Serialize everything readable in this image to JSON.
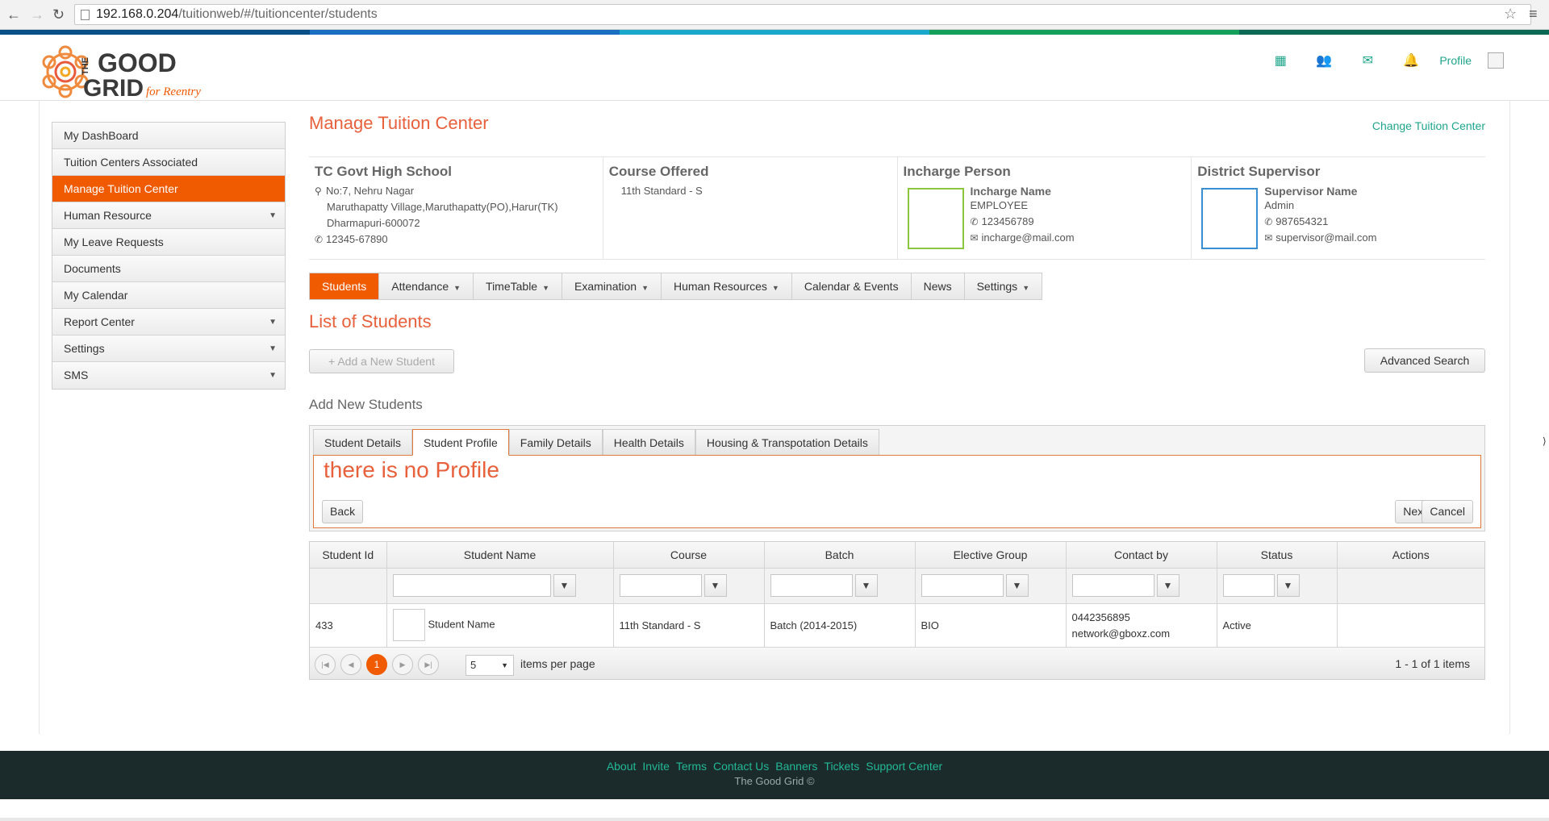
{
  "browser": {
    "url_host": "192.168.0.204",
    "url_path": "/tuitionweb/#/tuitioncenter/students"
  },
  "brand": {
    "logo_the": "THE",
    "logo_good": "GOOD",
    "logo_grid": "GRID",
    "logo_tag": "for Reentry",
    "stripe_colors": [
      "#0a4f85",
      "#1b6fc0",
      "#1ba7c9",
      "#13a05a",
      "#0c6a54"
    ],
    "accent": "#f05a00",
    "title_color": "#e8603c",
    "link_color": "#1fa58c"
  },
  "header": {
    "icons": [
      "apps-grid-icon",
      "users-icon",
      "mail-icon",
      "bell-icon"
    ],
    "profile_label": "Profile"
  },
  "sidebar": {
    "items": [
      {
        "label": "My DashBoard",
        "has_caret": false
      },
      {
        "label": "Tuition Centers Associated",
        "has_caret": false
      },
      {
        "label": "Manage Tuition Center",
        "has_caret": false,
        "active": true
      },
      {
        "label": "Human Resource",
        "has_caret": true
      },
      {
        "label": "My Leave Requests",
        "has_caret": false
      },
      {
        "label": "Documents",
        "has_caret": false
      },
      {
        "label": "My Calendar",
        "has_caret": false
      },
      {
        "label": "Report Center",
        "has_caret": true
      },
      {
        "label": "Settings",
        "has_caret": true
      },
      {
        "label": "SMS",
        "has_caret": true
      }
    ]
  },
  "main": {
    "title": "Manage Tuition Center",
    "change_link": "Change Tuition Center",
    "center": {
      "name": "TC Govt High School",
      "address1": "No:7, Nehru Nagar",
      "address2": "Maruthapatty Village,Maruthapatty(PO),Harur(TK)",
      "address3": "Dharmapuri-600072",
      "phone": "12345-67890"
    },
    "course": {
      "heading": "Course Offered",
      "value": "11th Standard - S"
    },
    "incharge": {
      "heading": "Incharge Person",
      "name": "Incharge Name",
      "role": "EMPLOYEE",
      "phone": "123456789",
      "email": "incharge@mail.com"
    },
    "supervisor": {
      "heading": "District Supervisor",
      "name": "Supervisor Name",
      "role": "Admin",
      "phone": "987654321",
      "email": "supervisor@mail.com"
    },
    "tabs": [
      {
        "label": "Students",
        "caret": false,
        "active": true
      },
      {
        "label": "Attendance",
        "caret": true
      },
      {
        "label": "TimeTable",
        "caret": true
      },
      {
        "label": "Examination",
        "caret": true
      },
      {
        "label": "Human Resources",
        "caret": true
      },
      {
        "label": "Calendar & Events",
        "caret": false
      },
      {
        "label": "News",
        "caret": false
      },
      {
        "label": "Settings",
        "caret": true
      }
    ],
    "list_title": "List of Students",
    "add_button": "+ Add a New Student",
    "advanced_search": "Advanced Search",
    "add_new_title": "Add New Students",
    "form_tabs": [
      {
        "label": "Student Details"
      },
      {
        "label": "Student Profile",
        "active": true
      },
      {
        "label": "Family Details"
      },
      {
        "label": "Health Details"
      },
      {
        "label": "Housing & Transpotation Details"
      }
    ],
    "form_message": "there is no Profile",
    "back_label": "Back",
    "next_label": "Next",
    "cancel_label": "Cancel"
  },
  "grid": {
    "columns": [
      "Student Id",
      "Student Name",
      "Course",
      "Batch",
      "Elective Group",
      "Contact by",
      "Status",
      "Actions"
    ],
    "rows": [
      {
        "id": "433",
        "name": "Student Name",
        "course": "11th Standard - S",
        "batch": "Batch (2014-2015)",
        "elective": "BIO",
        "contact_phone": "0442356895",
        "contact_email": "network@gboxz.com",
        "status": "Active"
      }
    ],
    "pager": {
      "current_page": "1",
      "page_size": "5",
      "items_per_page_label": "items per page",
      "count_label": "1 - 1 of 1 items"
    }
  },
  "footer": {
    "links": [
      "About",
      "Invite",
      "Terms",
      "Contact Us",
      "Banners",
      "Tickets",
      "Support Center"
    ],
    "copyright": "The Good Grid ©"
  }
}
